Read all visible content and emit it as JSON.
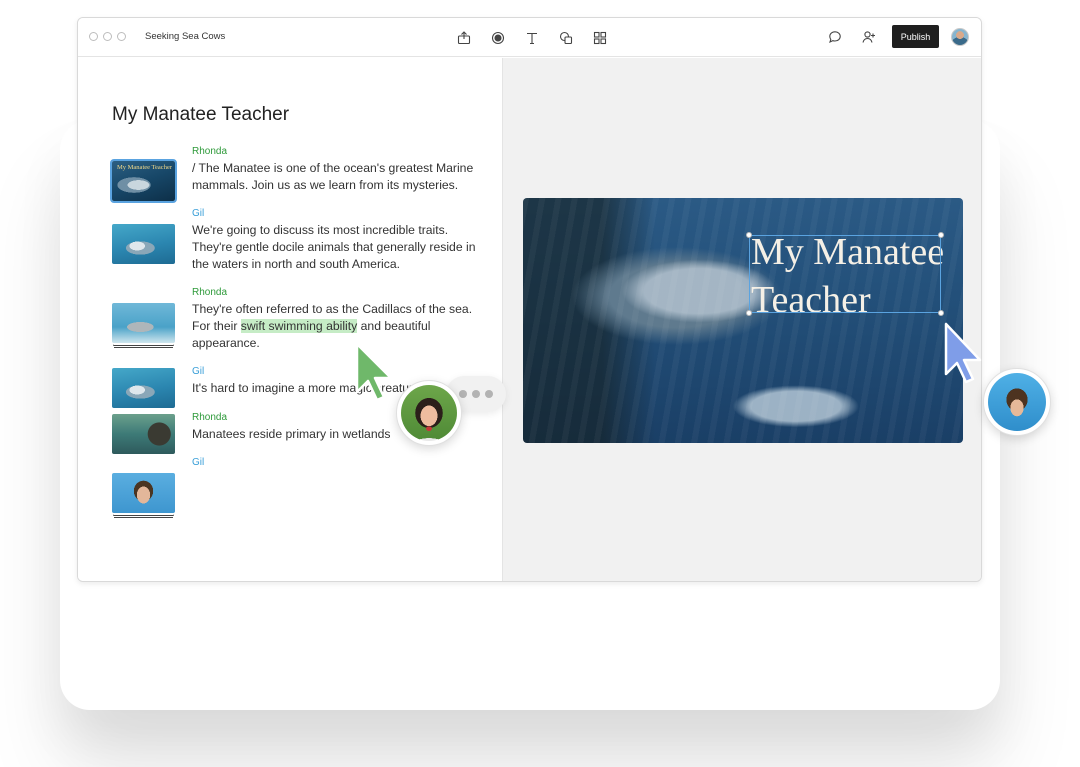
{
  "window": {
    "title": "Seeking Sea Cows"
  },
  "toolbar": {
    "tools": [
      {
        "name": "export-icon"
      },
      {
        "name": "record-icon"
      },
      {
        "name": "text-icon"
      },
      {
        "name": "shapes-icon"
      },
      {
        "name": "grid-icon"
      }
    ],
    "comment_icon": "comment-icon",
    "add_user_icon": "add-user-icon",
    "publish_label": "Publish"
  },
  "script": {
    "title": "My Manatee Teacher",
    "rows": [
      {
        "speaker": "Rhonda",
        "lines": [
          "/ The Manatee is one of the ocean's greatest Marine",
          "mammals. Join us as we learn from its mysteries."
        ]
      },
      {
        "speaker": "Gil",
        "lines": [
          "We're going to discuss its most incredible traits.",
          "They're gentle docile animals that generally reside in",
          "the waters in north and south America."
        ]
      },
      {
        "speaker": "Rhonda",
        "lines_pre": "They're often referred to as the Cadillacs of the sea.",
        "line2_pre": "For their ",
        "line2_hl": "swift swimming ability",
        "line2_post": " and beautiful",
        "line3": "appearance."
      },
      {
        "speaker": "Gil",
        "lines": [
          "It's hard to imagine a more magic creature"
        ]
      },
      {
        "speaker": "Rhonda",
        "lines": [
          "Manatees reside primary in wetlands"
        ]
      },
      {
        "speaker": "Gil",
        "lines": []
      }
    ],
    "thumb_title": "My Manatee Teacher"
  },
  "canvas": {
    "slide_title_line1": "My Manatee",
    "slide_title_line2": "Teacher"
  },
  "colors": {
    "rhonda": "#2e9a3a",
    "gil": "#3a9fd8",
    "highlight": "#c6ecc6",
    "selection": "#5aa3e0",
    "publish_bg": "#1f1f1f"
  }
}
